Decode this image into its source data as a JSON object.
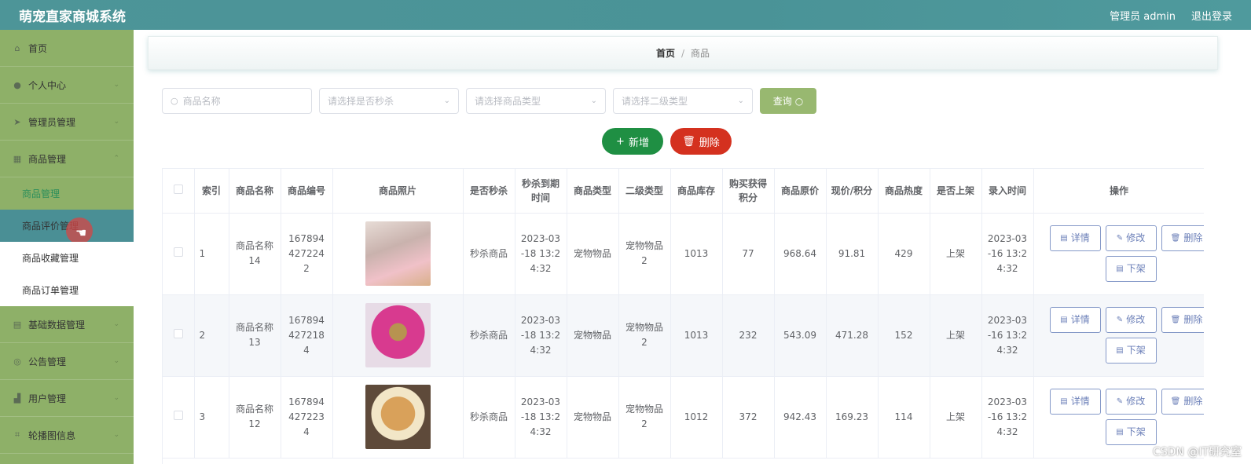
{
  "header": {
    "title": "萌宠直家商城系统",
    "user_label": "管理员 admin",
    "logout_label": "退出登录"
  },
  "sidebar": {
    "items": [
      {
        "label": "首页",
        "icon": "home-icon"
      },
      {
        "label": "个人中心",
        "icon": "user-icon"
      },
      {
        "label": "管理员管理",
        "icon": "send-icon"
      },
      {
        "label": "商品管理",
        "icon": "grid-icon"
      }
    ],
    "sub_items": [
      {
        "label": "商品管理"
      },
      {
        "label": "商品评价管理"
      },
      {
        "label": "商品收藏管理"
      },
      {
        "label": "商品订单管理"
      }
    ],
    "bottom_items": [
      {
        "label": "基础数据管理",
        "icon": "data-icon"
      },
      {
        "label": "公告管理",
        "icon": "notice-icon"
      },
      {
        "label": "用户管理",
        "icon": "users-icon"
      },
      {
        "label": "轮播图信息",
        "icon": "crop-icon"
      }
    ]
  },
  "breadcrumb": {
    "home": "首页",
    "separator": "/",
    "current": "商品"
  },
  "search": {
    "name_placeholder": "商品名称",
    "seckill_placeholder": "请选择是否秒杀",
    "type_placeholder": "请选择商品类型",
    "subtype_placeholder": "请选择二级类型",
    "query_label": "查询"
  },
  "actions": {
    "add_label": "新增",
    "delete_label": "删除"
  },
  "table": {
    "headers": [
      "索引",
      "商品名称",
      "商品编号",
      "商品照片",
      "是否秒杀",
      "秒杀到期时间",
      "商品类型",
      "二级类型",
      "商品库存",
      "购买获得积分",
      "商品原价",
      "现价/积分",
      "商品热度",
      "是否上架",
      "录入时间",
      "操作"
    ],
    "rows": [
      {
        "index": "1",
        "name": "商品名称14",
        "code": "1678944272242",
        "seckill": "秒杀商品",
        "expire": "2023-03-18 13:24:32",
        "type": "宠物物品",
        "subtype": "宠物物品2",
        "stock": "1013",
        "points": "77",
        "orig_price": "968.64",
        "price": "91.81",
        "heat": "429",
        "on_shelf": "上架",
        "created": "2023-03-16 13:24:32"
      },
      {
        "index": "2",
        "name": "商品名称13",
        "code": "1678944272184",
        "seckill": "秒杀商品",
        "expire": "2023-03-18 13:24:32",
        "type": "宠物物品",
        "subtype": "宠物物品2",
        "stock": "1013",
        "points": "232",
        "orig_price": "543.09",
        "price": "471.28",
        "heat": "152",
        "on_shelf": "上架",
        "created": "2023-03-16 13:24:32"
      },
      {
        "index": "3",
        "name": "商品名称12",
        "code": "1678944272234",
        "seckill": "秒杀商品",
        "expire": "2023-03-18 13:24:32",
        "type": "宠物物品",
        "subtype": "宠物物品2",
        "stock": "1012",
        "points": "372",
        "orig_price": "942.43",
        "price": "169.23",
        "heat": "114",
        "on_shelf": "上架",
        "created": "2023-03-16 13:24:32"
      }
    ],
    "op_labels": {
      "detail": "详情",
      "edit": "修改",
      "delete": "删除",
      "offshelf": "下架"
    }
  },
  "watermark": "CSDN @IT研究室"
}
